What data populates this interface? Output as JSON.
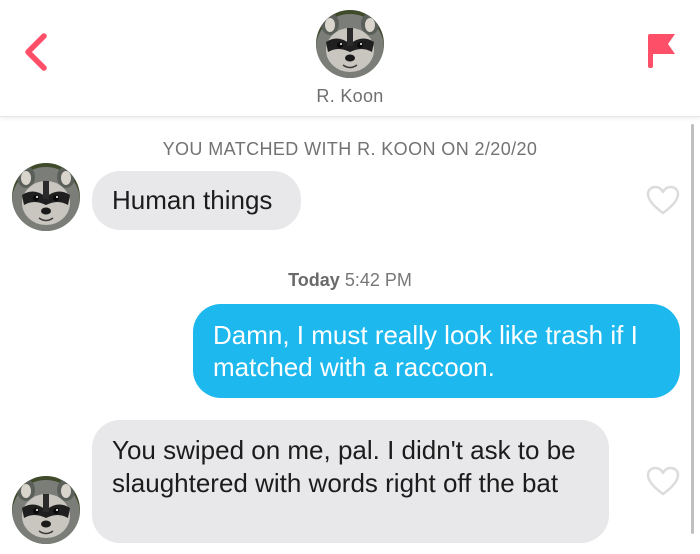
{
  "header": {
    "name": "R. Koon",
    "back_icon": "chevron-left-icon",
    "flag_icon": "flag-icon",
    "accent_color": "#fd5068"
  },
  "conversation": {
    "match_notice": "YOU MATCHED WITH R. KOON ON 2/20/20",
    "timestamp_day": "Today",
    "timestamp_time": "5:42 PM",
    "messages": [
      {
        "sender": "R. Koon",
        "direction": "incoming",
        "text": "Human things"
      },
      {
        "sender": "me",
        "direction": "outgoing",
        "text": "Damn, I must really look like trash if I matched with a raccoon."
      },
      {
        "sender": "R. Koon",
        "direction": "incoming",
        "text": "You swiped on me, pal. I didn't ask to be slaughtered with words right off the bat"
      }
    ],
    "incoming_bubble_color": "#e8e8ea",
    "outgoing_bubble_color": "#1cb8ee",
    "heart_icon": "heart-outline-icon"
  }
}
